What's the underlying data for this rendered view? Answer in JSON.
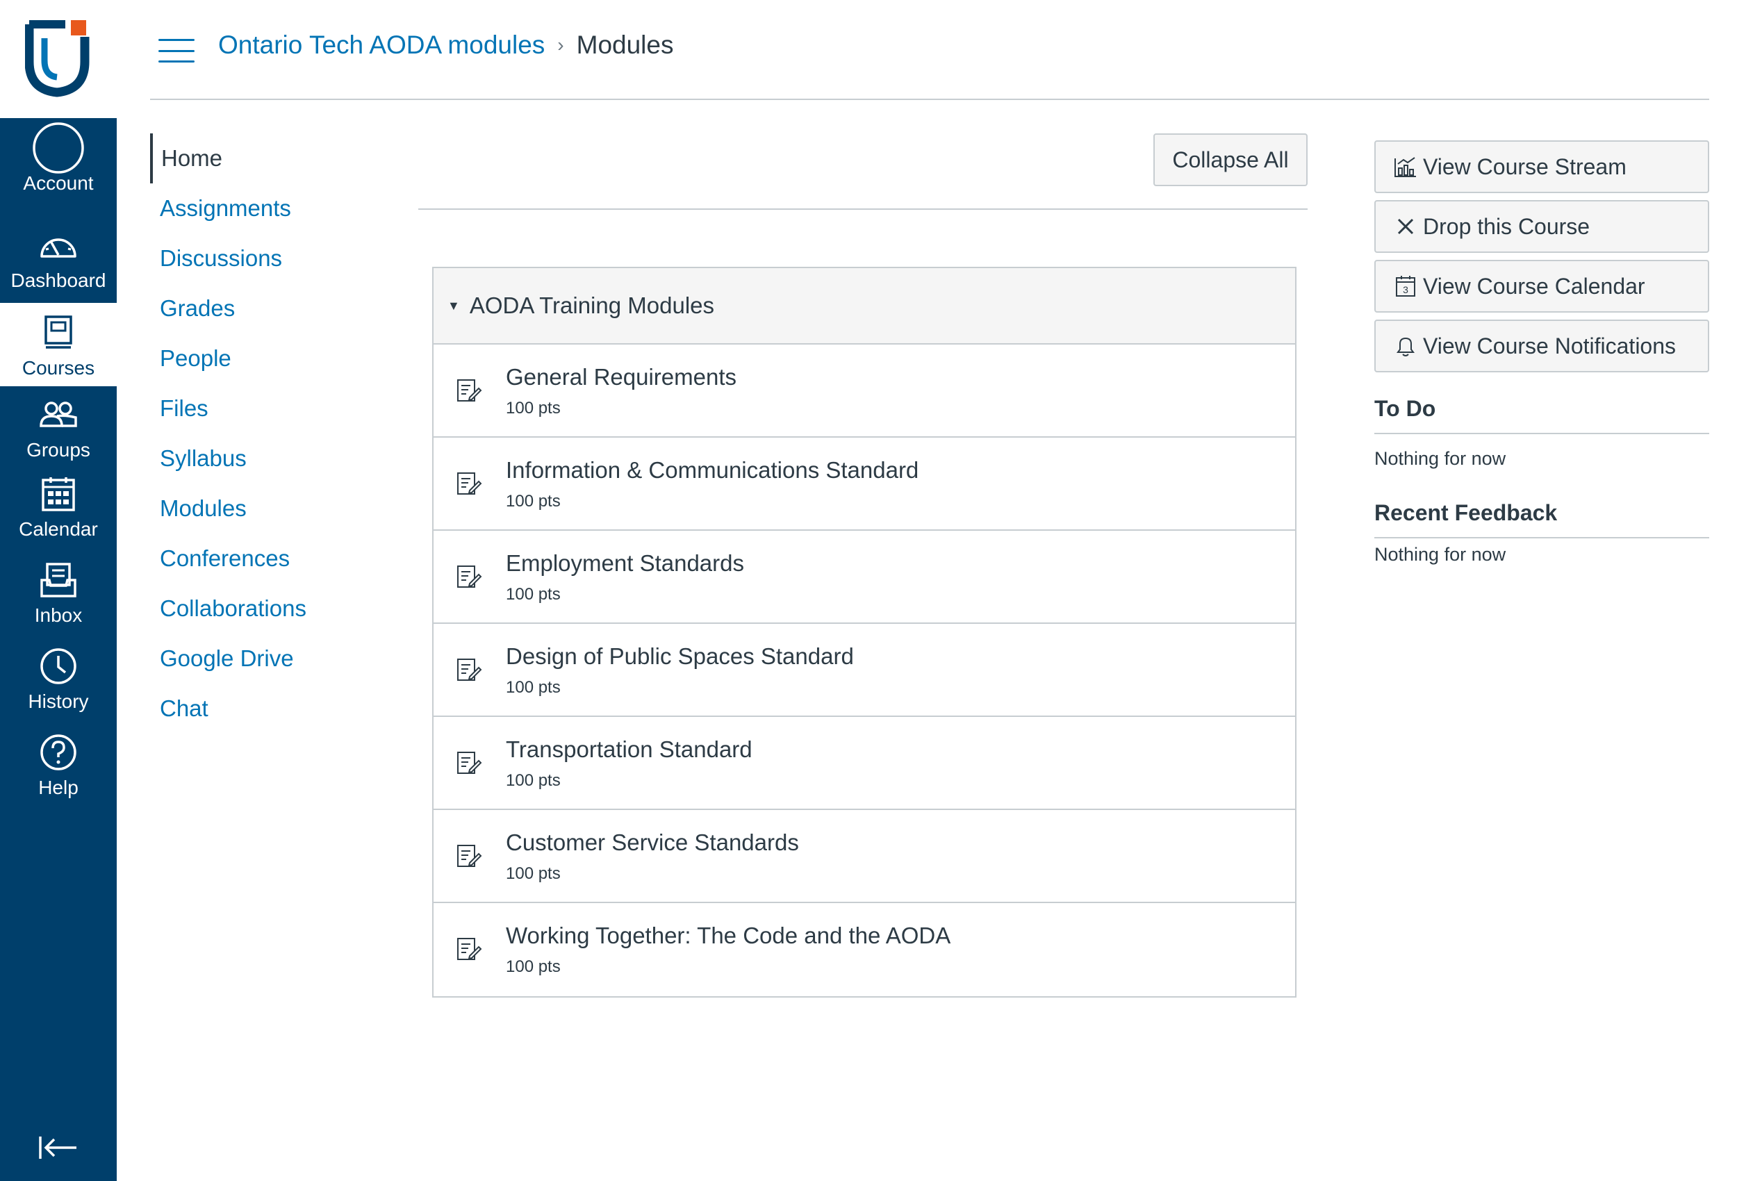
{
  "global_nav": {
    "items": [
      {
        "label": "Account",
        "icon": "account-circle-icon"
      },
      {
        "label": "Dashboard",
        "icon": "dashboard-gauge-icon"
      },
      {
        "label": "Courses",
        "icon": "courses-book-icon"
      },
      {
        "label": "Groups",
        "icon": "groups-people-icon"
      },
      {
        "label": "Calendar",
        "icon": "calendar-icon"
      },
      {
        "label": "Inbox",
        "icon": "inbox-icon"
      },
      {
        "label": "History",
        "icon": "history-clock-icon"
      },
      {
        "label": "Help",
        "icon": "help-question-icon"
      }
    ],
    "active": "Courses",
    "colors": {
      "background": "#003f6b",
      "accent": "#0374b5",
      "logo_orange": "#e8581c"
    }
  },
  "header": {
    "breadcrumb_course": "Ontario Tech AODA modules",
    "breadcrumb_separator": "›",
    "breadcrumb_current": "Modules"
  },
  "course_nav": {
    "items": [
      "Home",
      "Assignments",
      "Discussions",
      "Grades",
      "People",
      "Files",
      "Syllabus",
      "Modules",
      "Conferences",
      "Collaborations",
      "Google Drive",
      "Chat"
    ],
    "active": "Home"
  },
  "content": {
    "collapse_all_label": "Collapse All",
    "module": {
      "title": "AODA Training Modules",
      "caret": "▼",
      "items": [
        {
          "title": "General Requirements",
          "points": "100 pts"
        },
        {
          "title": "Information & Communications Standard",
          "points": "100 pts"
        },
        {
          "title": "Employment Standards",
          "points": "100 pts"
        },
        {
          "title": "Design of Public Spaces Standard",
          "points": "100 pts"
        },
        {
          "title": "Transportation Standard",
          "points": "100 pts"
        },
        {
          "title": "Customer Service Standards",
          "points": "100 pts"
        },
        {
          "title": "Working Together: The Code and the AODA",
          "points": "100 pts"
        }
      ]
    }
  },
  "sidebar": {
    "buttons": [
      {
        "label": "View Course Stream",
        "icon": "stream-chart-icon"
      },
      {
        "label": "Drop this Course",
        "icon": "close-x-icon"
      },
      {
        "label": "View Course Calendar",
        "icon": "calendar-day-icon"
      },
      {
        "label": "View Course Notifications",
        "icon": "bell-icon"
      }
    ],
    "calendar_icon_day": "3",
    "todo": {
      "heading": "To Do",
      "empty_text": "Nothing for now"
    },
    "feedback": {
      "heading": "Recent Feedback",
      "empty_text": "Nothing for now"
    }
  }
}
